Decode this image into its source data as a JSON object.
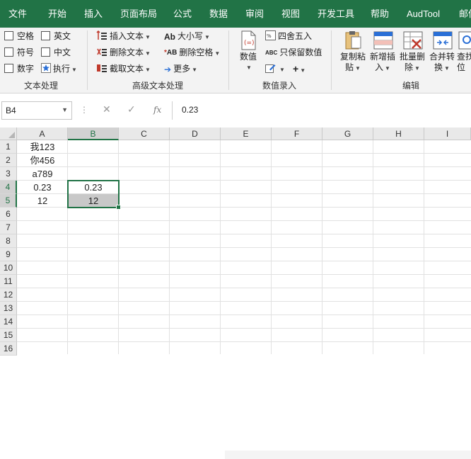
{
  "menu": {
    "tabs": [
      "文件",
      "开始",
      "插入",
      "页面布局",
      "公式",
      "数据",
      "审阅",
      "视图",
      "开发工具",
      "帮助",
      "AudTool",
      "邮件"
    ]
  },
  "ribbon": {
    "text_processing": {
      "items": [
        "空格",
        "英文",
        "符号",
        "中文",
        "数字",
        "执行"
      ],
      "label": "文本处理"
    },
    "advanced_text": {
      "insert": "插入文本",
      "delete": "删除文本",
      "extract": "截取文本",
      "case": "大小写",
      "delete_spaces": "删除空格",
      "more": "更多",
      "label": "高级文本处理"
    },
    "value_entry": {
      "value": "数值",
      "round": "四舍五入",
      "keep_value": "只保留数值",
      "label": "数值录入"
    },
    "edit": {
      "paste": [
        "复制粘",
        "贴"
      ],
      "insert": [
        "新增插",
        "入"
      ],
      "batch_delete": [
        "批量删",
        "除"
      ],
      "merge": [
        "合并转",
        "换"
      ],
      "find": [
        "查找",
        "位"
      ],
      "label": "编辑"
    }
  },
  "formula_bar": {
    "name_box": "B4",
    "cancel_icon": "✕",
    "confirm_icon": "✓",
    "fx": "fx",
    "value": "0.23"
  },
  "sheet": {
    "columns": [
      "A",
      "B",
      "C",
      "D",
      "E",
      "F",
      "G",
      "H",
      "I"
    ],
    "rows": [
      "1",
      "2",
      "3",
      "4",
      "5",
      "6",
      "7",
      "8",
      "9",
      "10",
      "11",
      "12",
      "13",
      "14",
      "15",
      "16"
    ],
    "cells": {
      "A1": "我123",
      "A2": "你456",
      "A3": "a789",
      "A4": "0.23",
      "A5": "12",
      "B4": "0.23",
      "B5": "12"
    },
    "accent_color": "#217346"
  }
}
